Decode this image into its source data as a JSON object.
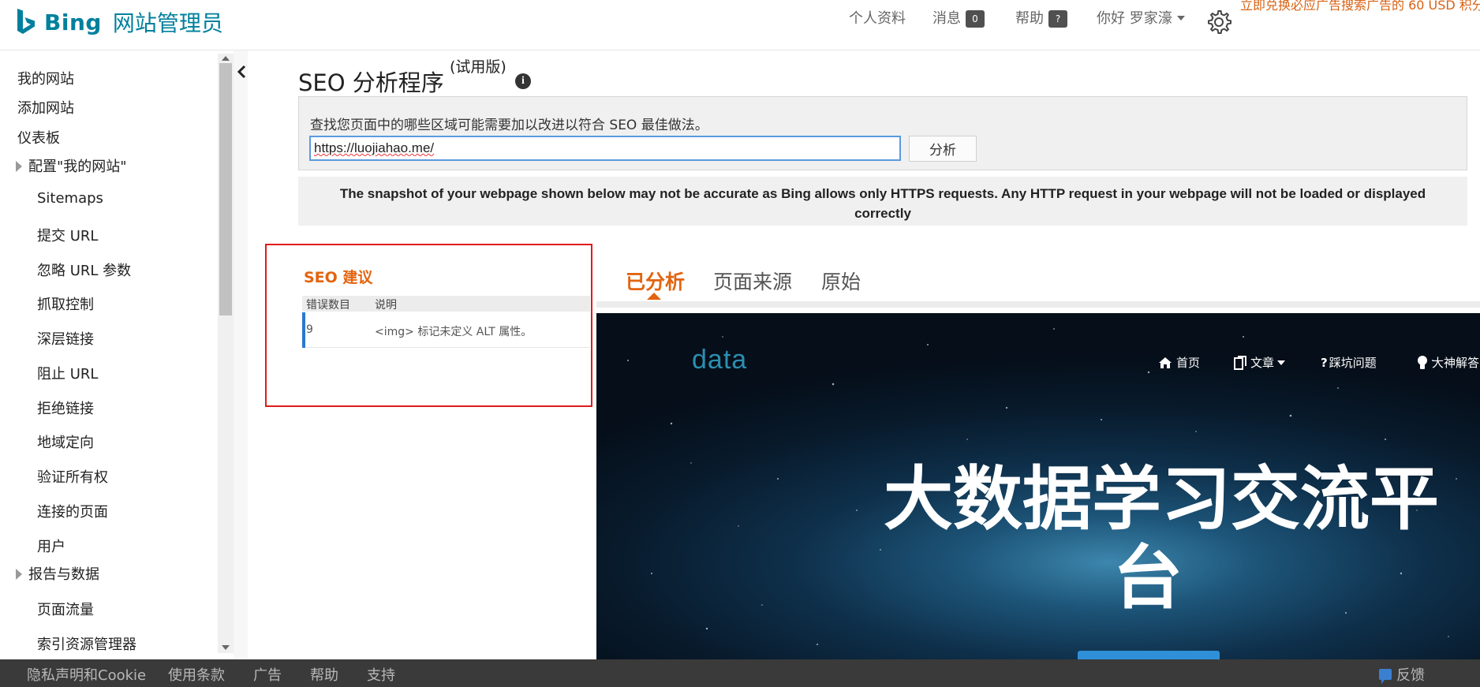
{
  "header": {
    "brand": "Bing",
    "product": "网站管理员",
    "profile": "个人资料",
    "messages": "消息",
    "messages_count": "0",
    "help": "帮助",
    "help_badge": "?",
    "greeting": "你好 罗家濠",
    "promo": "立即兑换必应广告搜索广告的 60 USD 积分"
  },
  "sidebar": {
    "items": [
      {
        "label": "我的网站"
      },
      {
        "label": "添加网站"
      },
      {
        "label": "仪表板"
      },
      {
        "label": "配置\"我的网站\""
      },
      {
        "label": "Sitemaps"
      },
      {
        "label": "提交 URL"
      },
      {
        "label": "忽略 URL 参数"
      },
      {
        "label": "抓取控制"
      },
      {
        "label": "深层链接"
      },
      {
        "label": "阻止 URL"
      },
      {
        "label": "拒绝链接"
      },
      {
        "label": "地域定向"
      },
      {
        "label": "验证所有权"
      },
      {
        "label": "连接的页面"
      },
      {
        "label": "用户"
      },
      {
        "label": "报告与数据"
      },
      {
        "label": "页面流量"
      },
      {
        "label": "索引资源管理器"
      }
    ]
  },
  "main": {
    "title": "SEO 分析程序",
    "title_sup": "(试用版)",
    "info_glyph": "i",
    "description": "查找您页面中的哪些区域可能需要加以改进以符合 SEO 最佳做法。",
    "url_value": "https://luojiahao.me/",
    "analyze_label": "分析",
    "notice": "The snapshot of your webpage shown below may not be accurate as Bing allows only HTTPS requests. Any HTTP request in your webpage will not be loaded or displayed correctly"
  },
  "seo": {
    "title": "SEO 建议",
    "col_errors": "错误数目",
    "col_desc": "说明",
    "rows": [
      {
        "count": "9",
        "desc": "<img> 标记未定义 ALT 属性。"
      }
    ]
  },
  "preview_tabs": [
    {
      "label": "已分析",
      "active": true
    },
    {
      "label": "页面来源",
      "active": false
    },
    {
      "label": "原始",
      "active": false
    }
  ],
  "preview": {
    "logo": "data",
    "nav": [
      "首页",
      "文章",
      "踩坑问题",
      "大神解答"
    ],
    "hero_line1": "大数据学习交流平",
    "hero_line2": "台"
  },
  "footer": {
    "links": [
      "隐私声明和Cookie",
      "使用条款",
      "广告",
      "帮助",
      "支持"
    ],
    "feedback": "反馈"
  },
  "colors": {
    "brand": "#00809d",
    "accent_orange": "#e2640f",
    "error_red": "#e01b1b",
    "footer_bg": "#3a3a3a"
  }
}
